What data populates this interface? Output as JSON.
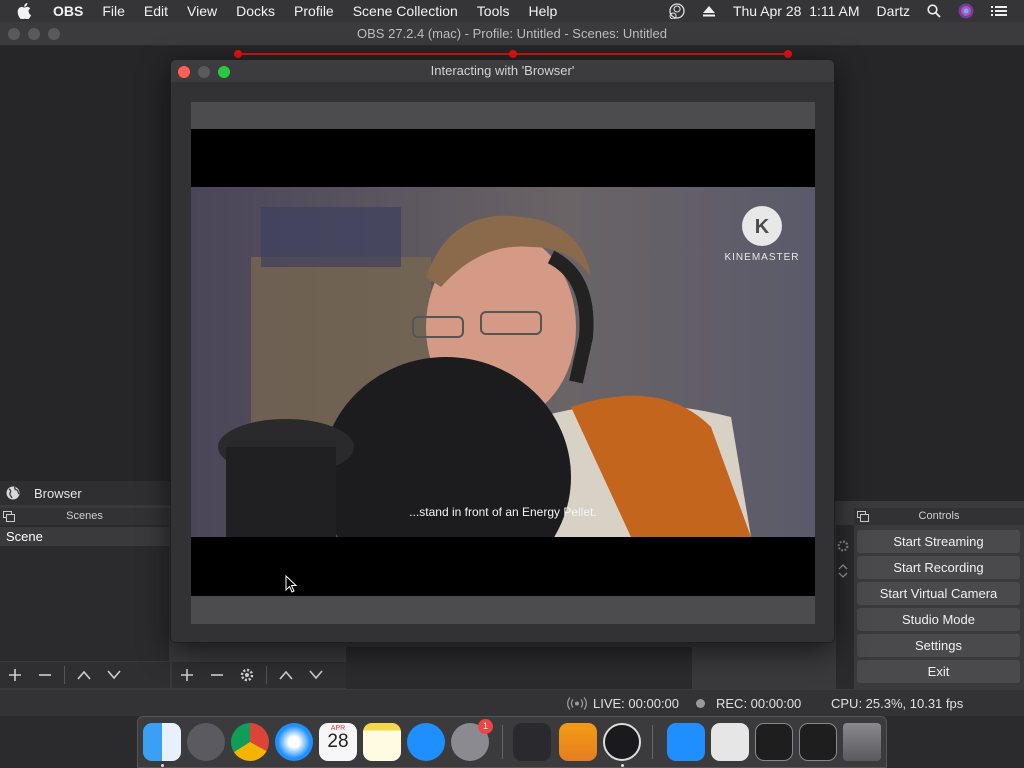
{
  "menubar": {
    "items": [
      "OBS",
      "File",
      "Edit",
      "View",
      "Docks",
      "Profile",
      "Scene Collection",
      "Tools",
      "Help"
    ],
    "datetime": "Thu Apr 28  1:11 AM",
    "user": "Dartz"
  },
  "obs": {
    "title": "OBS 27.2.4 (mac) - Profile: Untitled - Scenes: Untitled",
    "source_label": "Browser",
    "scenes_header": "Scenes",
    "scene_item": "Scene",
    "controls_header": "Controls",
    "controls": [
      "Start Streaming",
      "Start Recording",
      "Start Virtual Camera",
      "Studio Mode",
      "Settings",
      "Exit"
    ],
    "status": {
      "live": "LIVE: 00:00:00",
      "rec": "REC: 00:00:00",
      "cpu": "CPU: 25.3%, 10.31 fps"
    }
  },
  "interact": {
    "title": "Interacting with 'Browser'",
    "subtitle": "...stand in front of an Energy Pellet.",
    "watermark": "KINEMASTER"
  },
  "dock": {
    "calendar_month": "APR",
    "calendar_day": "28",
    "badge": "1"
  },
  "colors": {
    "accent_red": "#d11111",
    "button_bg": "#4a4a4c"
  }
}
